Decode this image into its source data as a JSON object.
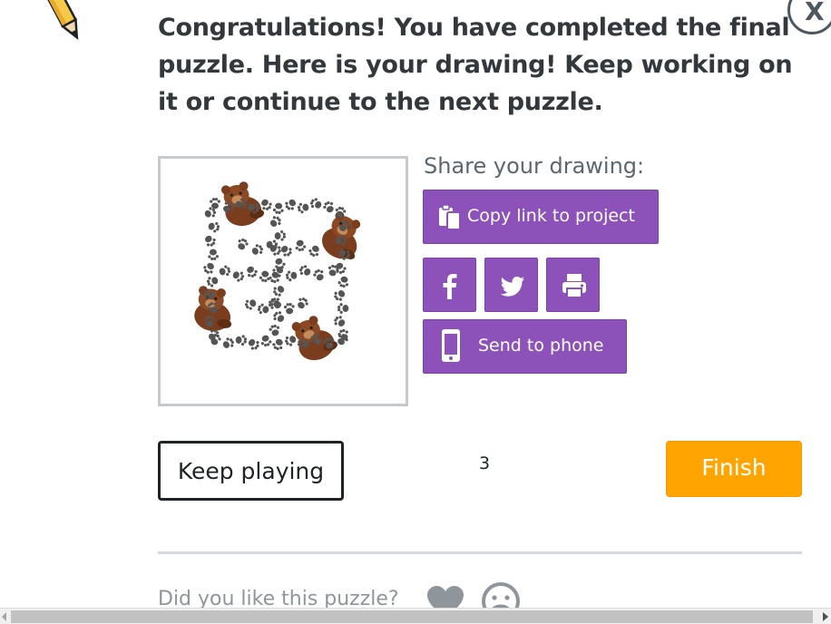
{
  "dialog": {
    "message": "Congratulations! You have completed the final puzzle. Here is your drawing! Keep working on it or continue to the next puzzle.",
    "close_label": "X"
  },
  "share": {
    "title": "Share your drawing:",
    "copy_link_label": "Copy link to project",
    "send_to_phone_label": "Send to phone",
    "social_icons": [
      "facebook-icon",
      "twitter-icon",
      "print-icon"
    ]
  },
  "actions": {
    "keep_playing_label": "Keep playing",
    "counter": "3",
    "finish_label": "Finish"
  },
  "feedback": {
    "question": "Did you like this puzzle?"
  },
  "colors": {
    "share_purple": "#8c52ba",
    "finish_orange": "#ffa400",
    "text_dark": "#33383d",
    "paw_gray": "#555555",
    "bear_brown": "#7a3e1f"
  }
}
